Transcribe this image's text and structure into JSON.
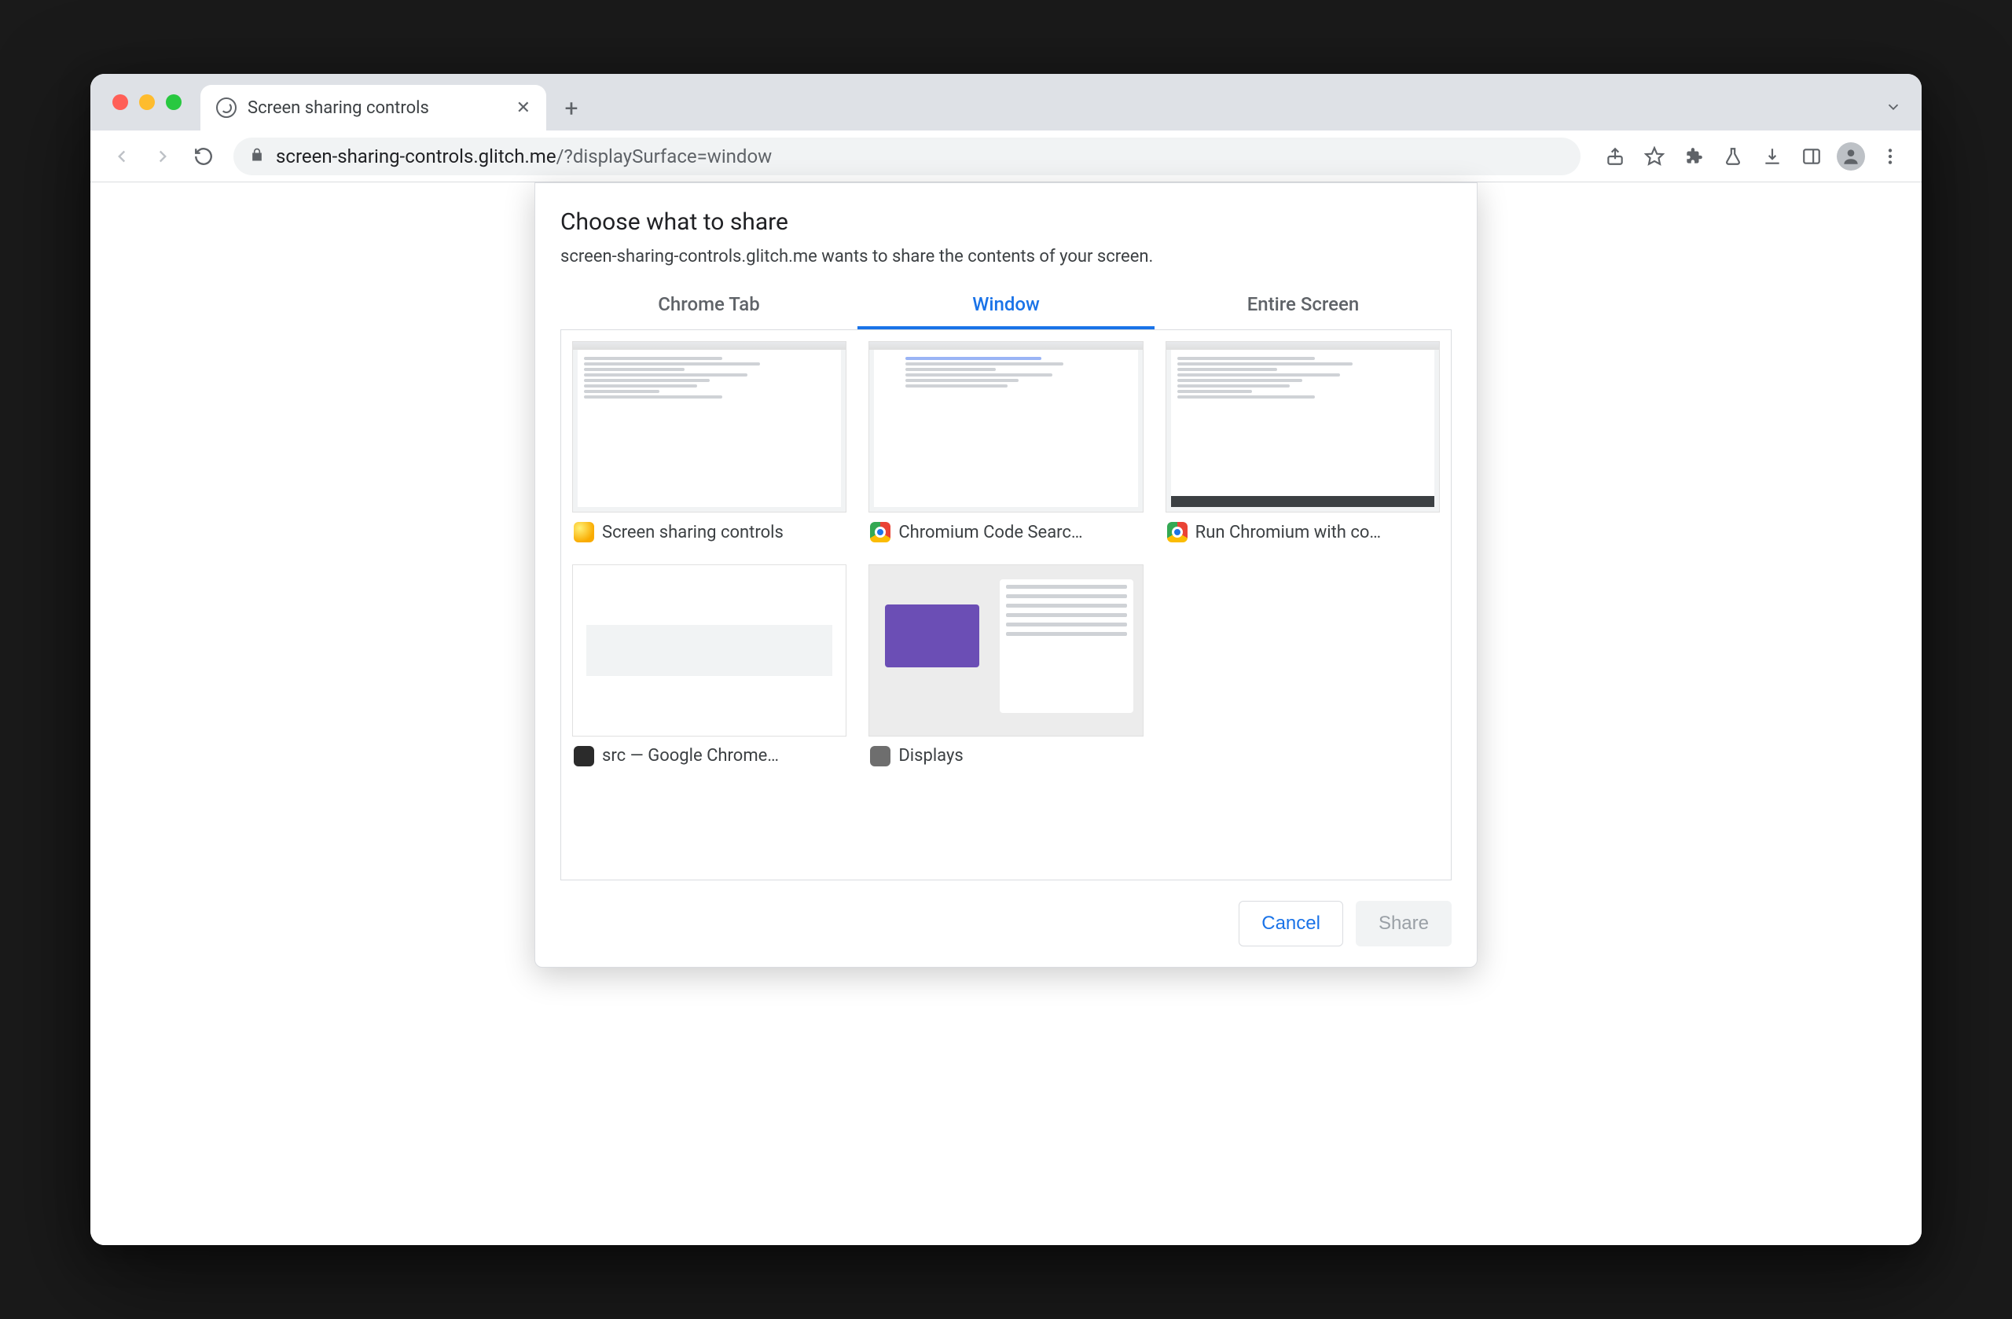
{
  "tab": {
    "title": "Screen sharing controls"
  },
  "address": {
    "host": "screen-sharing-controls.glitch.me",
    "path": "/?displaySurface=window"
  },
  "modal": {
    "title": "Choose what to share",
    "subtitle": "screen-sharing-controls.glitch.me wants to share the contents of your screen.",
    "tabs": {
      "chrome_tab": "Chrome Tab",
      "window": "Window",
      "entire_screen": "Entire Screen"
    },
    "windows": [
      {
        "label": "Screen sharing controls",
        "icon": "canary"
      },
      {
        "label": "Chromium Code Searc…",
        "icon": "chrome"
      },
      {
        "label": "Run Chromium with co…",
        "icon": "chrome"
      },
      {
        "label": "src — Google Chrome…",
        "icon": "term"
      },
      {
        "label": "Displays",
        "icon": "gear"
      }
    ],
    "buttons": {
      "cancel": "Cancel",
      "share": "Share"
    }
  }
}
